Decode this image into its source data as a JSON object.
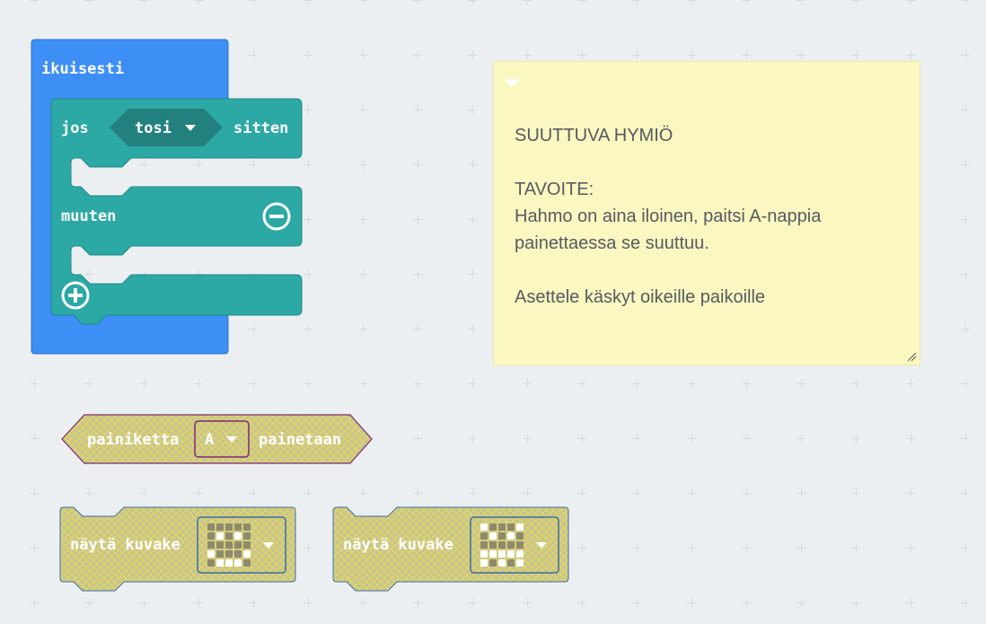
{
  "workspace": {
    "forever_block": {
      "label": "ikuisesti",
      "color": "#3d8ff5"
    },
    "if_block": {
      "if_label": "jos",
      "condition_value": "tosi",
      "then_label": "sitten",
      "else_label": "muuten",
      "color": "#2ca8a5",
      "remove_icon": "minus-circle-icon",
      "add_icon": "plus-circle-icon"
    },
    "button_block": {
      "prefix": "painiketta",
      "button_value": "A",
      "suffix": "painetaan",
      "disabled": true
    },
    "show_icon_blocks": [
      {
        "label": "näytä kuvake",
        "icon": "happy-face",
        "disabled": true
      },
      {
        "label": "näytä kuvake",
        "icon": "angry-face",
        "disabled": true
      }
    ]
  },
  "comment": {
    "lines": [
      "SUUTTUVA HYMIÖ",
      "",
      "TAVOITE:",
      "Hahmo on aina iloinen, paitsi A-nappia",
      "painettaessa se suuttuu.",
      "",
      "Asettele käskyt oikeille paikoille"
    ],
    "background": "#fbf7c0"
  },
  "icon_patterns": {
    "happy-face": [
      [
        0,
        0,
        0,
        0,
        0
      ],
      [
        0,
        1,
        0,
        1,
        0
      ],
      [
        0,
        0,
        0,
        0,
        0
      ],
      [
        1,
        0,
        0,
        0,
        1
      ],
      [
        0,
        1,
        1,
        1,
        0
      ]
    ],
    "angry-face": [
      [
        1,
        0,
        0,
        0,
        1
      ],
      [
        0,
        1,
        0,
        1,
        0
      ],
      [
        0,
        0,
        0,
        0,
        0
      ],
      [
        1,
        1,
        1,
        1,
        1
      ],
      [
        1,
        0,
        1,
        0,
        1
      ]
    ]
  }
}
